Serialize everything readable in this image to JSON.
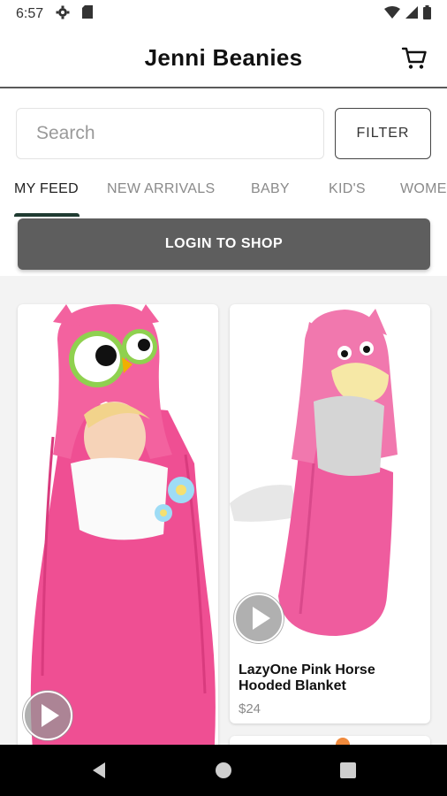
{
  "status_bar": {
    "time": "6:57"
  },
  "app_bar": {
    "title": "Jenni Beanies"
  },
  "search": {
    "placeholder": "Search",
    "filter_label": "FILTER"
  },
  "tabs": [
    {
      "label": "MY FEED"
    },
    {
      "label": "NEW ARRIVALS"
    },
    {
      "label": "BABY"
    },
    {
      "label": "KID'S"
    },
    {
      "label": "WOME"
    }
  ],
  "login_button": "LOGIN TO SHOP",
  "products": [
    {
      "name": "",
      "price": ""
    },
    {
      "name": "LazyOne Pink Horse Hooded Blanket",
      "price": "$24"
    }
  ],
  "colors": {
    "accent": "#1f3b31",
    "button": "#5e5e5e",
    "blanket_pink": "#f0569a"
  }
}
